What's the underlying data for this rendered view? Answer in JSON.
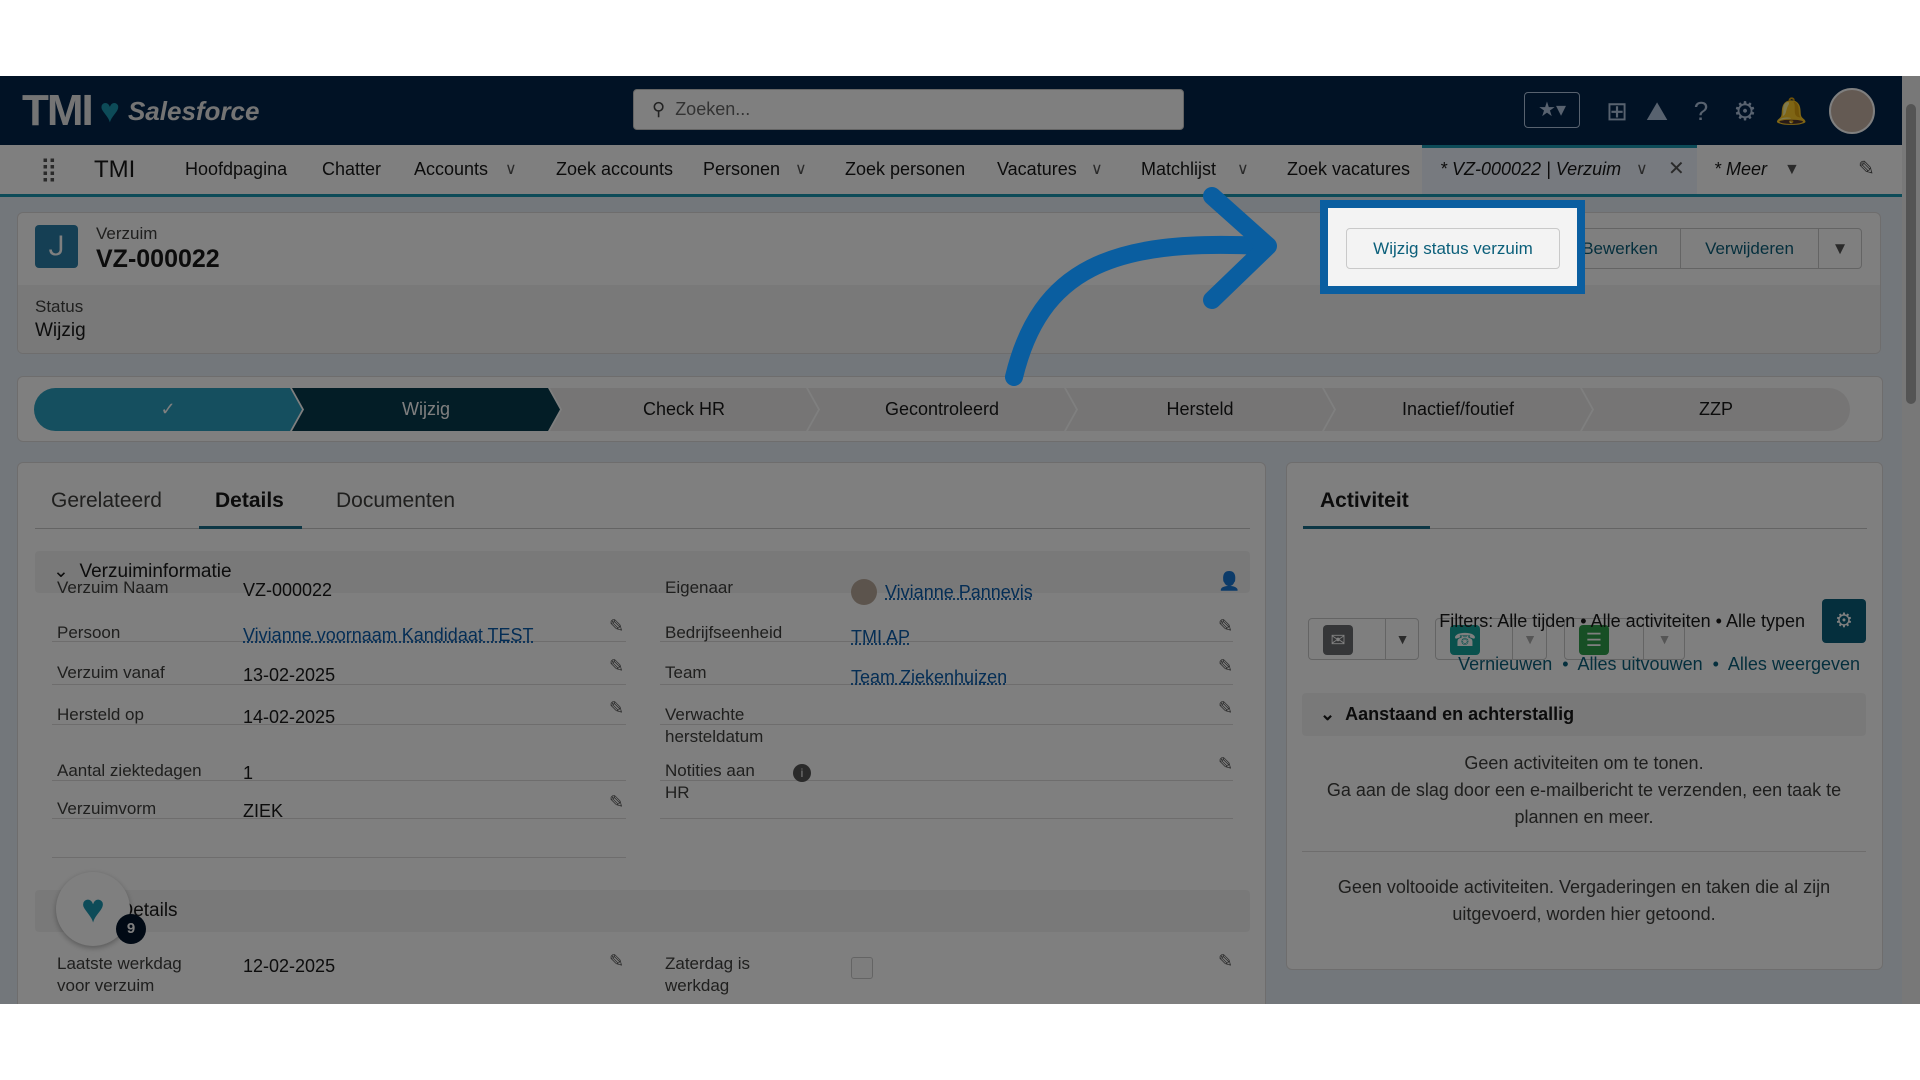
{
  "header": {
    "logo_text": "TMI",
    "logo_product": "Salesforce",
    "search_placeholder": "Zoeken...",
    "icons": [
      "star-icon",
      "add-icon",
      "trailhead-icon",
      "help-icon",
      "gear-icon",
      "bell-icon",
      "avatar"
    ]
  },
  "nav": {
    "app_name": "TMI",
    "items": [
      {
        "label": "Hoofdpagina"
      },
      {
        "label": "Chatter"
      },
      {
        "label": "Accounts",
        "dropdown": true
      },
      {
        "label": "Zoek accounts"
      },
      {
        "label": "Personen",
        "dropdown": true
      },
      {
        "label": "Zoek personen"
      },
      {
        "label": "Vacatures",
        "dropdown": true
      },
      {
        "label": "Matchlijst",
        "dropdown": true
      },
      {
        "label": "Zoek vacatures"
      }
    ],
    "active_tab": "* VZ-000022 | Verzuim",
    "more": "* Meer"
  },
  "record": {
    "object": "Verzuim",
    "name": "VZ-000022",
    "status_label": "Status",
    "status_value": "Wijzig",
    "actions": [
      "Wijzig status verzuim",
      "Bewerken",
      "Verwijderen"
    ]
  },
  "path": {
    "stages": [
      "✓",
      "Wijzig",
      "Check HR",
      "Gecontroleerd",
      "Hersteld",
      "Inactief/foutief",
      "ZZP"
    ],
    "completed": 1,
    "current": 1
  },
  "details": {
    "tabs": [
      "Gerelateerd",
      "Details",
      "Documenten"
    ],
    "active_tab": "Details",
    "section1": "Verzuiminformatie",
    "left": [
      {
        "label": "Verzuim Naam",
        "value": "VZ-000022"
      },
      {
        "label": "Persoon",
        "value": "Vivianne voornaam Kandidaat TEST",
        "link": true
      },
      {
        "label": "Verzuim vanaf",
        "value": "13-02-2025"
      },
      {
        "label": "Hersteld op",
        "value": "14-02-2025"
      },
      {
        "label": "Aantal ziektedagen",
        "value": "1"
      },
      {
        "label": "Verzuimvorm",
        "value": "ZIEK"
      }
    ],
    "right": [
      {
        "label": "Eigenaar",
        "value": "Vivianne Pannevis",
        "link": true
      },
      {
        "label": "Bedrijfseenheid",
        "value": "TMI AP",
        "link": true
      },
      {
        "label": "Team",
        "value": "Team Ziekenhuizen",
        "link": true
      },
      {
        "label": "Verwachte hersteldatum",
        "value": ""
      },
      {
        "label": "Notities aan HR",
        "value": ""
      }
    ],
    "section2": "Details",
    "s2_left": {
      "label": "Laatste werkdag voor verzuim",
      "value": "12-02-2025"
    },
    "s2_right": {
      "label": "Zaterdag is werkdag",
      "checked": false
    },
    "fab_badge": "9"
  },
  "activity": {
    "tab": "Activiteit",
    "filters": "Filters: Alle tijden • Alle activiteiten • Alle typen",
    "links": [
      "Vernieuwen",
      "Alles uitvouwen",
      "Alles weergeven"
    ],
    "section": "Aanstaand en achterstallig",
    "empty1": "Geen activiteiten om te tonen.",
    "empty2": "Ga aan de slag door een e-mailbericht te verzenden, een taak te plannen en meer.",
    "empty3": "Geen voltooide activiteiten. Vergaderingen en taken die al zijn uitgevoerd, worden hier getoond."
  },
  "colors": {
    "highlight": "#0a5ea0",
    "path_complete": "#2a9fbe",
    "path_current": "#063a4c",
    "header": "#02244a"
  }
}
